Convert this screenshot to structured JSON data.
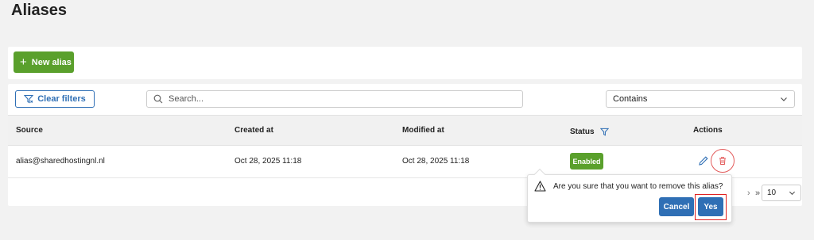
{
  "page": {
    "title": "Aliases"
  },
  "toolbar": {
    "new_alias_label": "New alias",
    "new_alias_icon": "plus-icon"
  },
  "filters": {
    "clear_label": "Clear filters",
    "search_placeholder": "Search...",
    "search_value": "",
    "match_mode": "Contains"
  },
  "table": {
    "columns": {
      "source": "Source",
      "created": "Created at",
      "modified": "Modified at",
      "status": "Status",
      "actions": "Actions"
    },
    "rows": [
      {
        "source": "alias@sharedhostingnl.nl",
        "created": "Oct 28, 2025 11:18",
        "modified": "Oct 28, 2025 11:18",
        "status": "Enabled"
      }
    ]
  },
  "pagination": {
    "next_glyph": "›",
    "last_glyph": "»",
    "page_size": "10"
  },
  "confirm": {
    "message": "Are you sure that you want to remove this alias?",
    "cancel_label": "Cancel",
    "yes_label": "Yes"
  },
  "colors": {
    "primary": "#2f6fb5",
    "success": "#5aa02c",
    "danger": "#e35a5a",
    "background": "#f2f2f2"
  }
}
